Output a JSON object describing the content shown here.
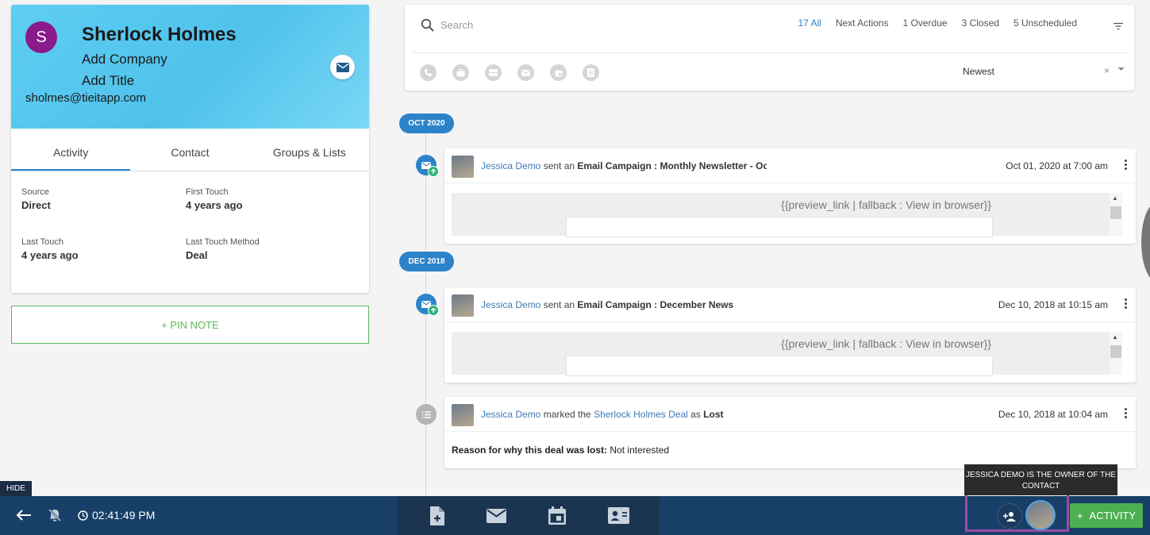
{
  "contact": {
    "initial": "S",
    "name": "Sherlock Holmes",
    "add_company": "Add Company",
    "add_title": "Add Title",
    "email": "sholmes@tieitapp.com",
    "tabs": [
      "Activity",
      "Contact",
      "Groups & Lists"
    ],
    "fields": {
      "source_label": "Source",
      "source_value": "Direct",
      "first_touch_label": "First Touch",
      "first_touch_value": "4 years ago",
      "last_touch_label": "Last Touch",
      "last_touch_value": "4 years ago",
      "last_method_label": "Last Touch Method",
      "last_method_value": "Deal"
    },
    "pin_note": "+ PIN NOTE"
  },
  "filter": {
    "search_placeholder": "Search",
    "counts": [
      "17 All",
      "Next Actions",
      "1 Overdue",
      "3 Closed",
      "5 Unscheduled"
    ],
    "sort_value": "Newest",
    "clear_symbol": "×",
    "type_icons": [
      "phone-icon",
      "briefcase-icon",
      "note-icon",
      "email-icon",
      "calendar-icon",
      "task-icon"
    ]
  },
  "timeline": {
    "months": [
      "OCT 2020",
      "DEC 2018"
    ],
    "activities": [
      {
        "actor": "Jessica Demo",
        "verb": "sent an",
        "type_label": "Email Campaign :",
        "subject": "Monthly Newsletter - Oc",
        "date": "Oct 01, 2020 at 7:00 am",
        "preview": "{{preview_link | fallback : View in browser}}"
      },
      {
        "actor": "Jessica Demo",
        "verb": "sent an",
        "type_label": "Email Campaign :",
        "subject": "December News",
        "date": "Dec 10, 2018 at 10:15 am",
        "preview": "{{preview_link | fallback : View in browser}}"
      },
      {
        "actor": "Jessica Demo",
        "verb": "marked the",
        "deal": "Sherlock Holmes Deal",
        "as": "as",
        "status": "Lost",
        "date": "Dec 10, 2018 at 10:04 am",
        "reason_label": "Reason for why this deal was lost:",
        "reason_value": "Not interested"
      }
    ]
  },
  "bottombar": {
    "hide": "HIDE",
    "time": "02:41:49 PM",
    "owner_tooltip": "JESSICA DEMO IS THE OWNER OF THE CONTACT",
    "activity_button": "ACTIVITY",
    "activity_plus": "+"
  },
  "colors": {
    "accent": "#2c83c9",
    "header_blue": "#5ecdf2",
    "bar_navy": "#183f68",
    "success": "#4cb050",
    "avatar_purple": "#8b1a8b",
    "highlight_frame": "#9b4aa8"
  }
}
